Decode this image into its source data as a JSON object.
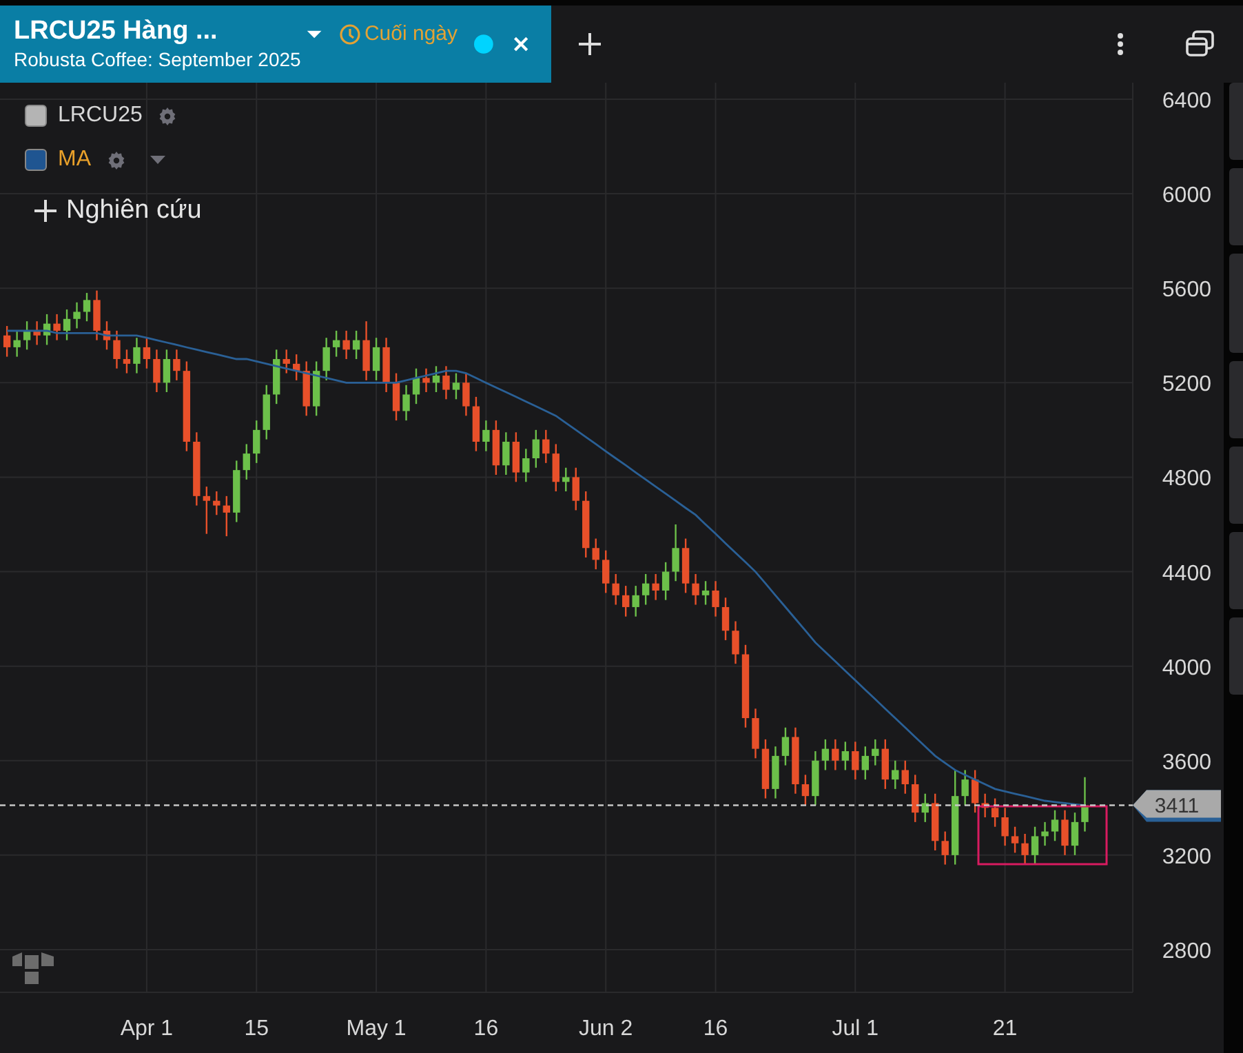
{
  "tab": {
    "title": "LRCU25 Hàng ...",
    "subtitle": "Robusta Coffee: September 2025",
    "mode": "Cuối ngày",
    "selected": true
  },
  "legend": [
    {
      "label": "LRCU25",
      "color": "#b4b4b4",
      "kind": "series"
    },
    {
      "color": "#1f5591",
      "kind": "indicator"
    }
  ],
  "add_study": {
    "label": "Nghiên cứu"
  },
  "chart_data": {
    "type": "candlestick",
    "grid": true,
    "ylim": [
      2619,
      6470
    ],
    "categories": [
      null,
      null,
      null,
      null,
      null,
      null,
      null,
      null,
      null,
      null,
      null,
      null,
      null,
      null,
      "Apr 1",
      null,
      null,
      null,
      null,
      null,
      null,
      null,
      null,
      null,
      null,
      "15",
      null,
      null,
      null,
      null,
      null,
      null,
      null,
      null,
      null,
      null,
      null,
      "May 1",
      null,
      null,
      null,
      null,
      null,
      null,
      null,
      null,
      null,
      null,
      "16",
      null,
      null,
      null,
      null,
      null,
      null,
      null,
      null,
      null,
      null,
      null,
      "Jun 2",
      null,
      null,
      null,
      null,
      null,
      null,
      null,
      null,
      null,
      null,
      "16",
      null,
      null,
      null,
      null,
      null,
      null,
      null,
      null,
      null,
      null,
      null,
      null,
      null,
      "Jul 1",
      null,
      null,
      null,
      null,
      null,
      null,
      null,
      null,
      null,
      null,
      null,
      null,
      null,
      null,
      "21",
      null,
      null,
      null,
      null,
      null,
      null,
      null,
      null
    ],
    "yticks": [
      2800,
      3200,
      3600,
      4000,
      4400,
      4800,
      5200,
      5600,
      6000,
      6400
    ],
    "ohlc": [
      [
        5400,
        5440,
        5310,
        5350
      ],
      [
        5350,
        5420,
        5310,
        5380
      ],
      [
        5380,
        5460,
        5340,
        5420
      ],
      [
        5420,
        5460,
        5360,
        5400
      ],
      [
        5400,
        5490,
        5360,
        5450
      ],
      [
        5450,
        5490,
        5380,
        5420
      ],
      [
        5420,
        5510,
        5380,
        5470
      ],
      [
        5470,
        5540,
        5430,
        5500
      ],
      [
        5500,
        5580,
        5460,
        5550
      ],
      [
        5550,
        5590,
        5380,
        5420
      ],
      [
        5420,
        5460,
        5340,
        5380
      ],
      [
        5380,
        5420,
        5260,
        5300
      ],
      [
        5300,
        5340,
        5240,
        5280
      ],
      [
        5280,
        5390,
        5240,
        5350
      ],
      [
        5350,
        5390,
        5260,
        5300
      ],
      [
        5300,
        5340,
        5160,
        5200
      ],
      [
        5200,
        5340,
        5160,
        5300
      ],
      [
        5300,
        5340,
        5210,
        5250
      ],
      [
        5250,
        5290,
        4910,
        4950
      ],
      [
        4950,
        4990,
        4680,
        4720
      ],
      [
        4720,
        4760,
        4560,
        4700
      ],
      [
        4700,
        4740,
        4640,
        4680
      ],
      [
        4680,
        4720,
        4550,
        4650
      ],
      [
        4650,
        4870,
        4610,
        4830
      ],
      [
        4830,
        4940,
        4790,
        4900
      ],
      [
        4900,
        5040,
        4860,
        5000
      ],
      [
        5000,
        5190,
        4960,
        5150
      ],
      [
        5150,
        5340,
        5110,
        5300
      ],
      [
        5300,
        5340,
        5240,
        5280
      ],
      [
        5280,
        5320,
        5210,
        5250
      ],
      [
        5250,
        5290,
        5060,
        5100
      ],
      [
        5100,
        5290,
        5060,
        5250
      ],
      [
        5250,
        5390,
        5210,
        5350
      ],
      [
        5350,
        5420,
        5310,
        5380
      ],
      [
        5380,
        5420,
        5300,
        5340
      ],
      [
        5340,
        5420,
        5300,
        5380
      ],
      [
        5380,
        5460,
        5210,
        5250
      ],
      [
        5250,
        5390,
        5210,
        5350
      ],
      [
        5350,
        5390,
        5160,
        5200
      ],
      [
        5200,
        5240,
        5040,
        5080
      ],
      [
        5080,
        5190,
        5040,
        5150
      ],
      [
        5150,
        5260,
        5110,
        5220
      ],
      [
        5220,
        5260,
        5160,
        5200
      ],
      [
        5200,
        5270,
        5160,
        5230
      ],
      [
        5230,
        5270,
        5130,
        5170
      ],
      [
        5170,
        5240,
        5130,
        5200
      ],
      [
        5200,
        5240,
        5060,
        5100
      ],
      [
        5100,
        5140,
        4910,
        4950
      ],
      [
        4950,
        5040,
        4910,
        5000
      ],
      [
        5000,
        5040,
        4810,
        4850
      ],
      [
        4850,
        4990,
        4810,
        4950
      ],
      [
        4950,
        4990,
        4780,
        4820
      ],
      [
        4820,
        4920,
        4780,
        4880
      ],
      [
        4880,
        5000,
        4840,
        4960
      ],
      [
        4960,
        5000,
        4860,
        4900
      ],
      [
        4900,
        4940,
        4740,
        4780
      ],
      [
        4780,
        4840,
        4740,
        4800
      ],
      [
        4800,
        4840,
        4660,
        4700
      ],
      [
        4700,
        4740,
        4460,
        4500
      ],
      [
        4500,
        4540,
        4410,
        4450
      ],
      [
        4450,
        4490,
        4310,
        4350
      ],
      [
        4350,
        4390,
        4260,
        4300
      ],
      [
        4300,
        4340,
        4210,
        4250
      ],
      [
        4250,
        4340,
        4210,
        4300
      ],
      [
        4300,
        4390,
        4260,
        4350
      ],
      [
        4350,
        4390,
        4280,
        4320
      ],
      [
        4320,
        4440,
        4280,
        4400
      ],
      [
        4400,
        4600,
        4360,
        4500
      ],
      [
        4500,
        4540,
        4310,
        4350
      ],
      [
        4350,
        4390,
        4260,
        4300
      ],
      [
        4300,
        4360,
        4260,
        4320
      ],
      [
        4320,
        4360,
        4210,
        4250
      ],
      [
        4250,
        4290,
        4110,
        4150
      ],
      [
        4150,
        4190,
        4010,
        4050
      ],
      [
        4050,
        4090,
        3740,
        3780
      ],
      [
        3780,
        3820,
        3610,
        3650
      ],
      [
        3650,
        3690,
        3440,
        3480
      ],
      [
        3480,
        3660,
        3440,
        3620
      ],
      [
        3620,
        3740,
        3580,
        3700
      ],
      [
        3700,
        3740,
        3460,
        3500
      ],
      [
        3500,
        3540,
        3410,
        3450
      ],
      [
        3450,
        3640,
        3410,
        3600
      ],
      [
        3600,
        3690,
        3560,
        3650
      ],
      [
        3650,
        3690,
        3560,
        3600
      ],
      [
        3600,
        3680,
        3560,
        3640
      ],
      [
        3640,
        3680,
        3520,
        3560
      ],
      [
        3560,
        3660,
        3520,
        3620
      ],
      [
        3620,
        3690,
        3580,
        3650
      ],
      [
        3650,
        3690,
        3480,
        3520
      ],
      [
        3520,
        3600,
        3480,
        3560
      ],
      [
        3560,
        3600,
        3460,
        3500
      ],
      [
        3500,
        3540,
        3340,
        3380
      ],
      [
        3380,
        3460,
        3340,
        3420
      ],
      [
        3420,
        3460,
        3220,
        3260
      ],
      [
        3260,
        3300,
        3160,
        3200
      ],
      [
        3200,
        3560,
        3160,
        3450
      ],
      [
        3450,
        3560,
        3410,
        3520
      ],
      [
        3520,
        3560,
        3380,
        3420
      ],
      [
        3420,
        3460,
        3360,
        3400
      ],
      [
        3400,
        3440,
        3320,
        3360
      ],
      [
        3360,
        3400,
        3240,
        3280
      ],
      [
        3280,
        3320,
        3210,
        3250
      ],
      [
        3250,
        3290,
        3160,
        3200
      ],
      [
        3200,
        3320,
        3160,
        3280
      ],
      [
        3280,
        3340,
        3240,
        3300
      ],
      [
        3300,
        3390,
        3260,
        3350
      ],
      [
        3350,
        3390,
        3200,
        3240
      ],
      [
        3240,
        3380,
        3200,
        3340
      ],
      [
        3340,
        3530,
        3300,
        3411
      ]
    ],
    "series": [
      {
        "name": "MA",
        "type": "line",
        "color": "#2a6096",
        "values": [
          5420,
          5420,
          5420,
          5420,
          5420,
          5410,
          5410,
          5410,
          5410,
          5410,
          5400,
          5400,
          5400,
          5400,
          5390,
          5380,
          5370,
          5360,
          5350,
          5340,
          5330,
          5320,
          5310,
          5300,
          5300,
          5290,
          5280,
          5270,
          5260,
          5250,
          5240,
          5230,
          5220,
          5210,
          5200,
          5200,
          5200,
          5200,
          5200,
          5200,
          5210,
          5220,
          5230,
          5240,
          5250,
          5250,
          5240,
          5220,
          5200,
          5180,
          5160,
          5140,
          5120,
          5100,
          5080,
          5060,
          5030,
          5000,
          4970,
          4940,
          4910,
          4880,
          4850,
          4820,
          4790,
          4760,
          4730,
          4700,
          4670,
          4640,
          4600,
          4560,
          4520,
          4480,
          4440,
          4400,
          4350,
          4300,
          4250,
          4200,
          4150,
          4100,
          4060,
          4020,
          3980,
          3940,
          3900,
          3860,
          3820,
          3780,
          3740,
          3700,
          3660,
          3620,
          3590,
          3560,
          3540,
          3520,
          3500,
          3480,
          3470,
          3460,
          3450,
          3440,
          3430,
          3425,
          3420,
          3415,
          3411
        ]
      }
    ],
    "ref_lines": [
      {
        "axis": "y",
        "value": 3411,
        "label": "3411"
      }
    ]
  }
}
